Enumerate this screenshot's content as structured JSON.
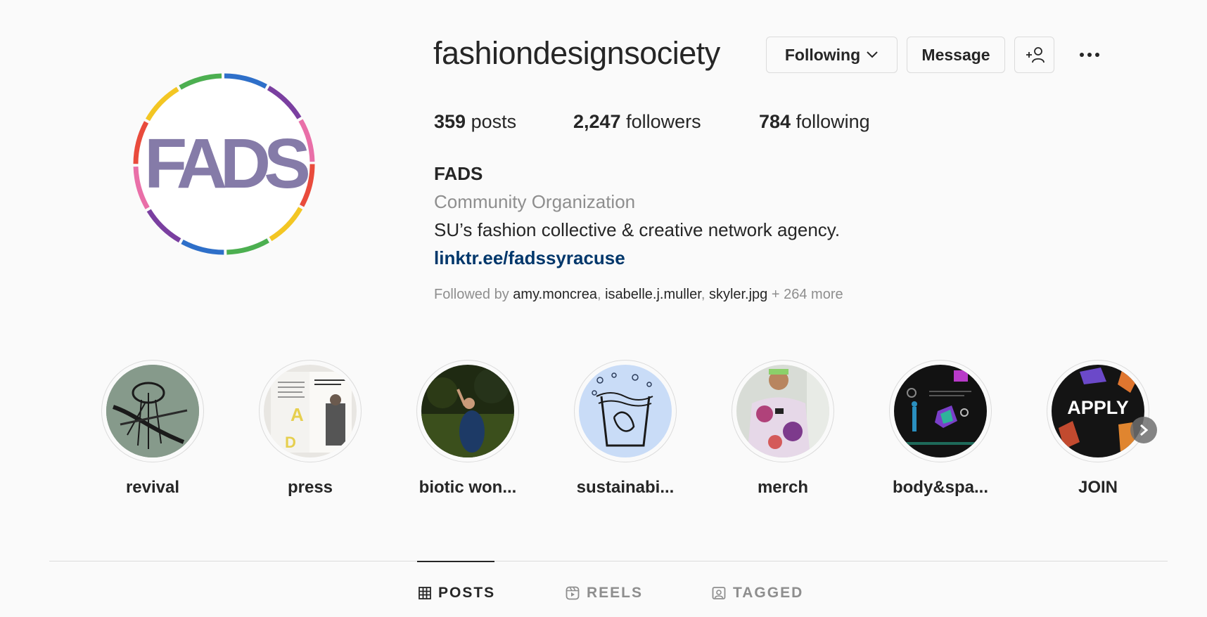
{
  "profile": {
    "username": "fashiondesignsociety",
    "avatar_text": "FADS",
    "buttons": {
      "following": "Following",
      "message": "Message"
    },
    "stats": {
      "posts_count": "359",
      "posts_label": "posts",
      "followers_count": "2,247",
      "followers_label": "followers",
      "following_count": "784",
      "following_label": "following"
    },
    "bio": {
      "name": "FADS",
      "category": "Community Organization",
      "text": "SU’s fashion collective & creative network agency.",
      "link": "linktr.ee/fadssyracuse"
    },
    "followed_by": {
      "prefix": "Followed by ",
      "users": [
        "amy.moncrea",
        "isabelle.j.muller",
        "skyler.jpg"
      ],
      "more": "+ 264 more"
    }
  },
  "highlights": [
    {
      "label": "revival",
      "icon": "revival-thumbnail"
    },
    {
      "label": "press",
      "icon": "press-thumbnail"
    },
    {
      "label": "biotic won...",
      "icon": "biotic-thumbnail"
    },
    {
      "label": "sustainabi...",
      "icon": "sustainability-thumbnail"
    },
    {
      "label": "merch",
      "icon": "merch-thumbnail"
    },
    {
      "label": "body&spa...",
      "icon": "body-space-thumbnail"
    },
    {
      "label": "JOIN",
      "icon": "join-thumbnail",
      "overlay_text": "APPLY"
    }
  ],
  "tabs": [
    {
      "label": "POSTS",
      "icon": "grid-icon",
      "active": true
    },
    {
      "label": "REELS",
      "icon": "reels-icon",
      "active": false
    },
    {
      "label": "TAGGED",
      "icon": "tagged-icon",
      "active": false
    }
  ],
  "colors": {
    "text_primary": "#262626",
    "text_secondary": "#8e8e8e",
    "link": "#00376b",
    "border": "#dbdbdb",
    "background": "#fafafa",
    "logo": "#857ba8"
  }
}
